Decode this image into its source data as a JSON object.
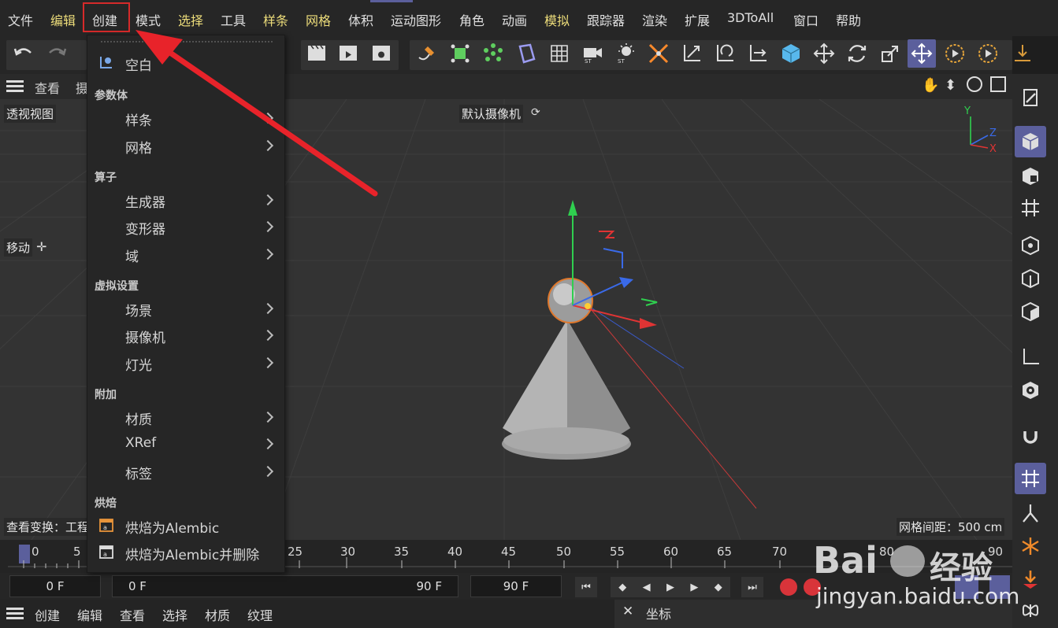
{
  "menubar": {
    "items": [
      "文件",
      "编辑",
      "创建",
      "模式",
      "选择",
      "工具",
      "样条",
      "网格",
      "体积",
      "运动图形",
      "角色",
      "动画",
      "模拟",
      "跟踪器",
      "渲染",
      "扩展",
      "3DToAll",
      "窗口",
      "帮助"
    ]
  },
  "viewbar": {
    "items": [
      "查看",
      "摄"
    ]
  },
  "viewport": {
    "view_name": "透视视图",
    "camera_label": "默认摄像机",
    "move_label": "移动",
    "transform_label": "查看变换：工程",
    "grid_spacing": "网格间距：500 cm",
    "axis": {
      "y": "Y",
      "z": "Z",
      "x": "X"
    }
  },
  "dropdown": {
    "null_item": "空白",
    "sections": [
      {
        "header": "参数体",
        "items": [
          "样条",
          "网格"
        ]
      },
      {
        "header": "算子",
        "items": [
          "生成器",
          "变形器",
          "域"
        ]
      },
      {
        "header": "虚拟设置",
        "items": [
          "场景",
          "摄像机",
          "灯光"
        ]
      },
      {
        "header": "附加",
        "items": [
          "材质",
          "XRef",
          "标签"
        ]
      },
      {
        "header": "烘焙",
        "items": [
          "烘焙为Alembic",
          "烘焙为Alembic并删除"
        ]
      }
    ]
  },
  "timeline": {
    "ticks": [
      "0",
      "5",
      "25",
      "30",
      "35",
      "40",
      "45",
      "50",
      "55",
      "60",
      "65",
      "70",
      "80",
      "90"
    ]
  },
  "transport": {
    "current_frame": "0 F",
    "range_start": "0 F",
    "range_end": "90 F",
    "end_frame": "90 F"
  },
  "bottom_menu": {
    "items": [
      "创建",
      "编辑",
      "查看",
      "选择",
      "材质",
      "纹理"
    ]
  },
  "coord_panel": {
    "title": "坐标"
  },
  "watermark": {
    "brand": "Bai",
    "brand_suffix": "经验",
    "url": "jingyan.baidu.com"
  },
  "colors": {
    "accent": "#5b5f9c",
    "highlight_menu": "#ecdc7a",
    "arrow": "#e8232a"
  }
}
